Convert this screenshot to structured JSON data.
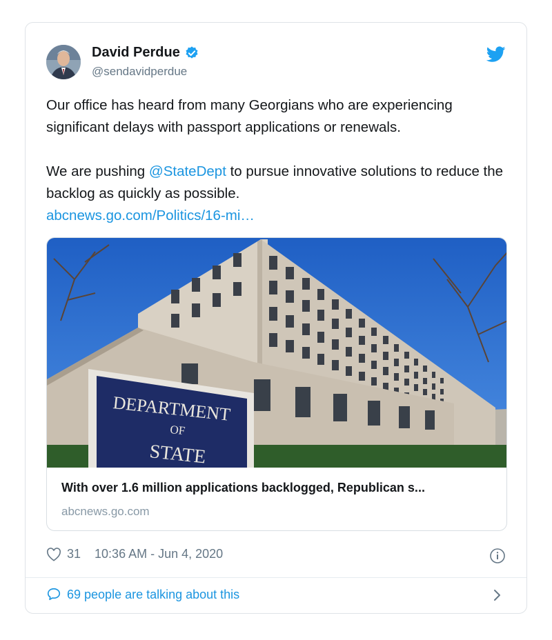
{
  "author": {
    "name": "David Perdue",
    "handle": "@sendavidperdue"
  },
  "tweet": {
    "paragraph1": "Our office has heard from many Georgians who are experiencing significant delays with passport applications or renewals.",
    "paragraph2_before": "We are pushing ",
    "mention": "@StateDept",
    "paragraph2_after": " to pursue innovative solutions to reduce the backlog as quickly as possible.",
    "link": "abcnews.go.com/Politics/16-mi…"
  },
  "card": {
    "title": "With over 1.6 million applications backlogged, Republican s...",
    "domain": "abcnews.go.com",
    "sign_line1": "DEPARTMENT",
    "sign_line2": "OF",
    "sign_line3": "STATE"
  },
  "footer": {
    "likes": "31",
    "timestamp": "10:36 AM - Jun 4, 2020",
    "talking": "69 people are talking about this"
  },
  "colors": {
    "accent": "#1b95e0",
    "verified": "#1da1f2",
    "muted": "#657786"
  },
  "icons": [
    "verified-badge-icon",
    "twitter-bird-icon",
    "heart-icon",
    "info-icon",
    "speech-bubble-icon",
    "chevron-right-icon"
  ]
}
